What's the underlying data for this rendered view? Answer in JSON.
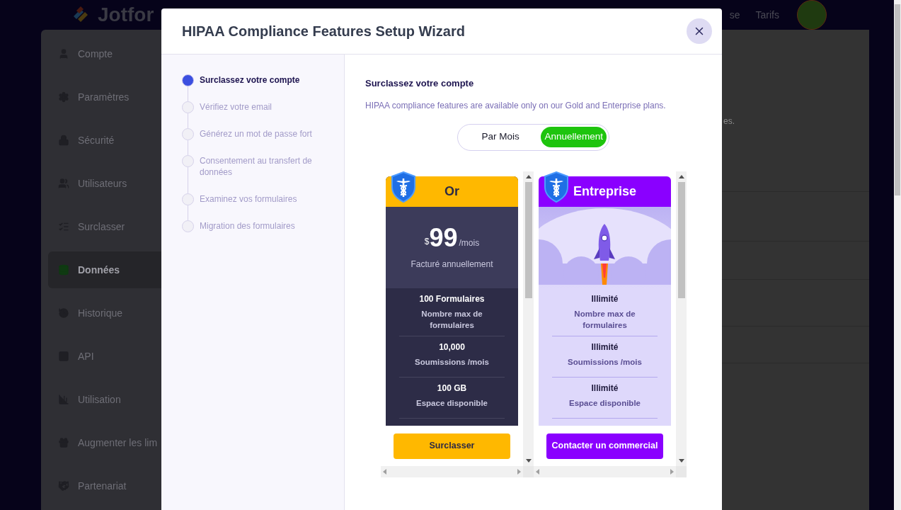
{
  "app": {
    "logo": "Jotfor",
    "nav": [
      "se",
      "Tarifs"
    ],
    "content_text": "es."
  },
  "sidebar": {
    "items": [
      {
        "label": "Compte",
        "selected": false
      },
      {
        "label": "Paramètres",
        "selected": false
      },
      {
        "label": "Sécurité",
        "selected": false
      },
      {
        "label": "Utilisateurs",
        "selected": false
      },
      {
        "label": "Surclasser",
        "selected": false
      },
      {
        "label": "Données",
        "selected": true
      },
      {
        "label": "Historique",
        "selected": false
      },
      {
        "label": "API",
        "selected": false
      },
      {
        "label": "Utilisation",
        "selected": false
      },
      {
        "label": "Augmenter les lim",
        "selected": false
      },
      {
        "label": "Partenariat",
        "selected": false
      }
    ]
  },
  "modal": {
    "title": "HIPAA Compliance Features Setup Wizard",
    "steps": [
      {
        "label": "Surclassez votre compte",
        "selected": true
      },
      {
        "label": "Vérifiez votre email",
        "selected": false
      },
      {
        "label": "Générez un mot de passe fort",
        "selected": false
      },
      {
        "label": "Consentement au transfert de données",
        "selected": false
      },
      {
        "label": "Examinez vos formulaires",
        "selected": false
      },
      {
        "label": "Migration des formulaires",
        "selected": false
      }
    ],
    "heading": "Surclassez votre compte",
    "description": "HIPAA compliance features are available only on our Gold and Enterprise plans.",
    "billing": [
      {
        "label": "Par Mois",
        "selected": false
      },
      {
        "label": "Annuellement",
        "selected": true
      }
    ],
    "plans": [
      {
        "kind": "gold",
        "name": "Or",
        "price": {
          "currency": "$",
          "amount": "99",
          "period": "/mois",
          "note": "Facturé annuellement"
        },
        "features": [
          {
            "value": "100 Formulaires",
            "label": "Nombre max de formulaires"
          },
          {
            "value": "10,000",
            "label": "Soumissions /mois"
          },
          {
            "value": "100 GB",
            "label": "Espace disponible"
          }
        ],
        "button": "Surclasser"
      },
      {
        "kind": "enterprise",
        "name": "Entreprise",
        "features": [
          {
            "value": "Illimité",
            "label": "Nombre max de formulaires"
          },
          {
            "value": "Illimité",
            "label": "Soumissions /mois"
          },
          {
            "value": "Illimité",
            "label": "Espace disponible"
          }
        ],
        "button": "Contacter un commercial"
      }
    ]
  }
}
